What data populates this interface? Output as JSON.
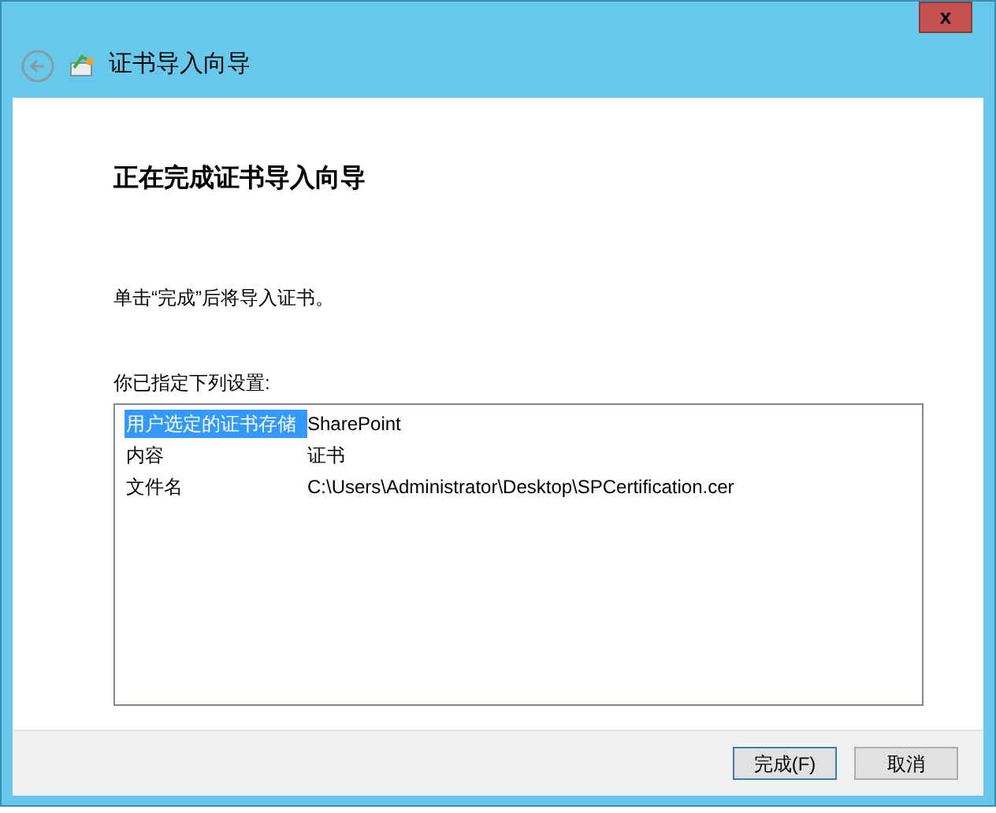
{
  "window": {
    "title": "证书导入向导",
    "close": "x"
  },
  "heading": "正在完成证书导入向导",
  "instruction": "单击“完成”后将导入证书。",
  "settings_label": "你已指定下列设置:",
  "settings": [
    {
      "name": "用户选定的证书存储",
      "value": "SharePoint",
      "selected": true
    },
    {
      "name": "内容",
      "value": "证书",
      "selected": false
    },
    {
      "name": "文件名",
      "value": "C:\\Users\\Administrator\\Desktop\\SPCertification.cer",
      "selected": false
    }
  ],
  "buttons": [
    {
      "label": "完成(F)",
      "default": true
    },
    {
      "label": "取消",
      "default": false
    }
  ]
}
